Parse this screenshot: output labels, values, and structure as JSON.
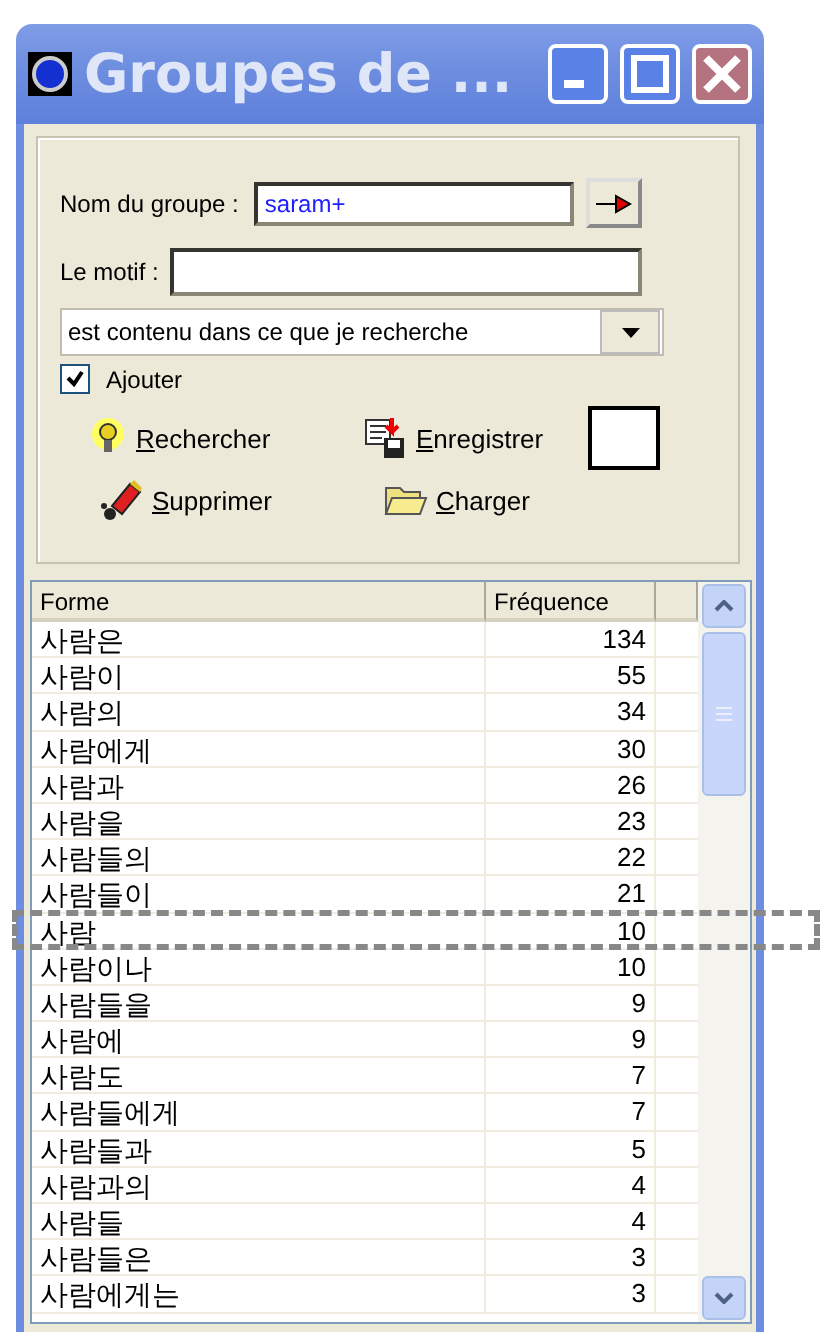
{
  "window": {
    "title": "Groupes de ..."
  },
  "form": {
    "group_name_label": "Nom du groupe :",
    "group_name_value": "saram+",
    "motif_label": "Le motif :",
    "match_mode": "est contenu dans ce que je recherche",
    "add_checkbox": {
      "label": "Ajouter",
      "checked": true
    },
    "actions": [
      {
        "label": "Rechercher",
        "kind": "search"
      },
      {
        "label": "Enregistrer",
        "kind": "save"
      },
      {
        "label": "Supprimer",
        "kind": "delete"
      },
      {
        "label": "Charger",
        "kind": "load"
      }
    ]
  },
  "table": {
    "columns": [
      "Forme",
      "Fréquence"
    ],
    "rows": [
      {
        "form": "사람은",
        "frequency": "134"
      },
      {
        "form": "사람이",
        "frequency": "55"
      },
      {
        "form": "사람의",
        "frequency": "34"
      },
      {
        "form": "사람에게",
        "frequency": "30"
      },
      {
        "form": "사람과",
        "frequency": "26"
      },
      {
        "form": "사람을",
        "frequency": "23"
      },
      {
        "form": "사람들의",
        "frequency": "22"
      },
      {
        "form": "사람들이",
        "frequency": "21"
      },
      {
        "form": "사람",
        "frequency": "10"
      },
      {
        "form": "사람이나",
        "frequency": "10"
      },
      {
        "form": "사람들을",
        "frequency": "9"
      },
      {
        "form": "사람에",
        "frequency": "9"
      },
      {
        "form": "사람도",
        "frequency": "7"
      },
      {
        "form": "사람들에게",
        "frequency": "7"
      },
      {
        "form": "사람들과",
        "frequency": "5"
      },
      {
        "form": "사람과의",
        "frequency": "4"
      },
      {
        "form": "사람들",
        "frequency": "4"
      },
      {
        "form": "사람들은",
        "frequency": "3"
      },
      {
        "form": "사람에게는",
        "frequency": "3"
      }
    ]
  }
}
